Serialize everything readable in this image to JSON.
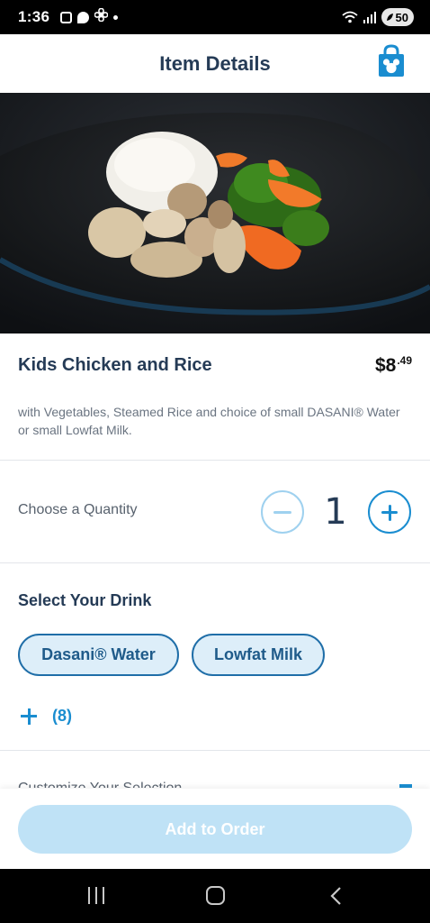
{
  "status_bar": {
    "time": "1:36",
    "battery": "50"
  },
  "header": {
    "title": "Item Details",
    "bag_icon": "mickey-shopping-bag-icon"
  },
  "item": {
    "name": "Kids Chicken and Rice",
    "price_dollars": "$8",
    "price_cents": ".49",
    "description": "with Vegetables, Steamed Rice and choice of small DASANI® Water or small Lowfat Milk."
  },
  "quantity": {
    "label": "Choose a Quantity",
    "value": "1"
  },
  "drink": {
    "title": "Select Your Drink",
    "options": [
      "Dasani® Water",
      "Lowfat Milk"
    ],
    "more_count": "(8)"
  },
  "customize": {
    "label": "Customize Your Selection"
  },
  "footer": {
    "add_button": "Add to Order"
  },
  "colors": {
    "accent": "#1a8dd0",
    "title_text": "#253b56",
    "chip_fill": "#ddeef9",
    "button_disabled": "#bfe2f6"
  }
}
